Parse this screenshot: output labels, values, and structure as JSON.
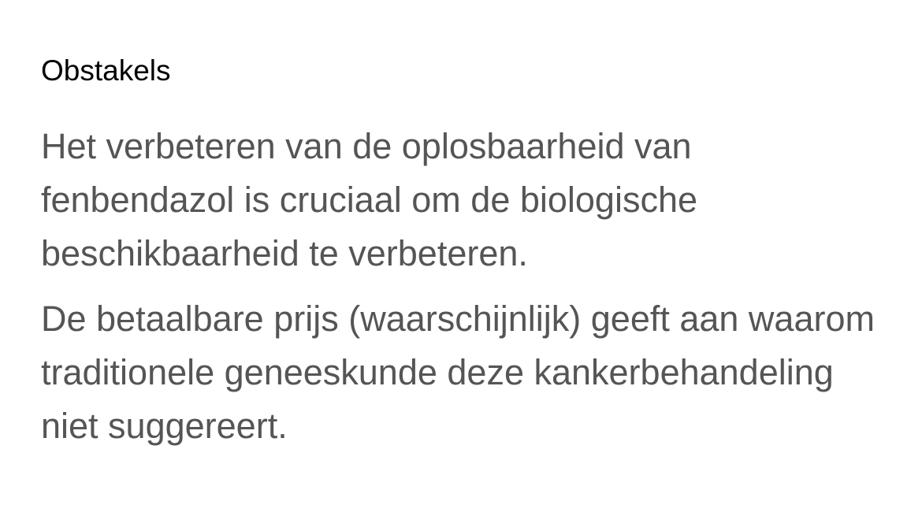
{
  "section": {
    "title": "Obstakels",
    "paragraphs": [
      "Het verbeteren van de oplosbaarheid van fenbendazol is cruciaal om de biologische beschikbaarheid te verbeteren.",
      "De betaalbare prijs (waarschijnlijk) geeft aan waarom traditionele geneeskunde deze kankerbehandeling niet suggereert."
    ]
  },
  "colors": {
    "heading": "#000000",
    "body_text": "#555555",
    "background": "#ffffff"
  }
}
